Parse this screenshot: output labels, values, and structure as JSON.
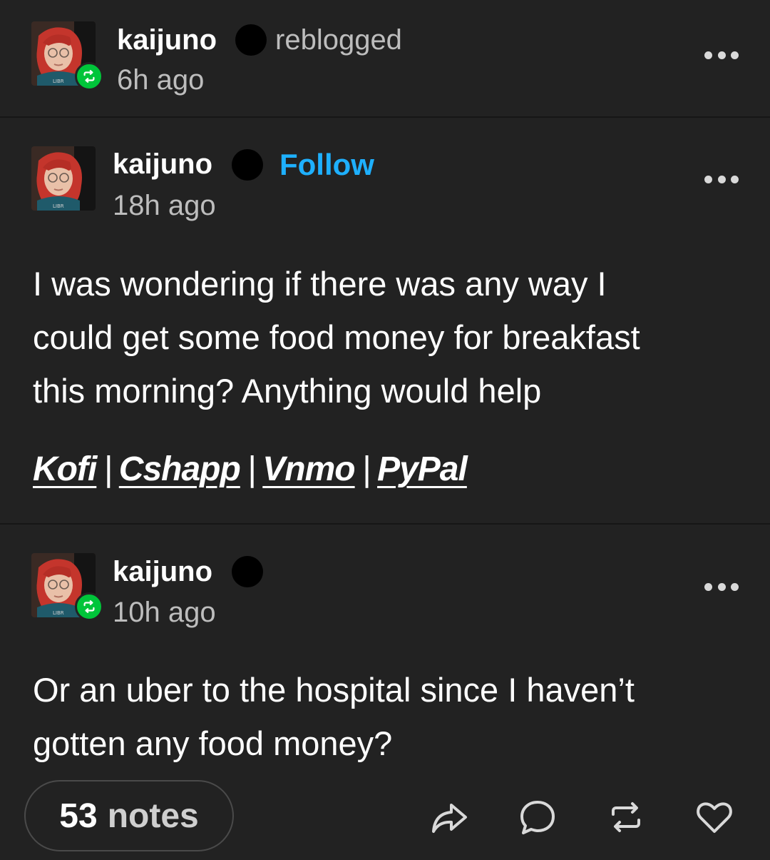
{
  "reblog_header": {
    "username": "kaijuno",
    "action": "reblogged",
    "timestamp": "6h ago"
  },
  "post_original": {
    "username": "kaijuno",
    "follow_label": "Follow",
    "timestamp": "18h ago",
    "body_lines": [
      "I was wondering if there was any way I",
      "could get some food money for breakfast",
      "this morning? Anything would help"
    ],
    "links": [
      "Kofi",
      "Cshapp",
      "Vnmo",
      "PyPal"
    ],
    "separator": "|"
  },
  "post_reblog": {
    "username": "kaijuno",
    "timestamp": "10h ago",
    "body_lines": [
      "Or an uber to the hospital since I haven’t",
      "gotten any food money?"
    ]
  },
  "footer": {
    "notes_count": "53",
    "notes_label": "notes",
    "actions": [
      "share-icon",
      "reply-icon",
      "reblog-icon",
      "like-icon"
    ]
  },
  "colors": {
    "background": "#222222",
    "follow": "#1eb0ff",
    "reblog_badge": "#00c53a"
  }
}
